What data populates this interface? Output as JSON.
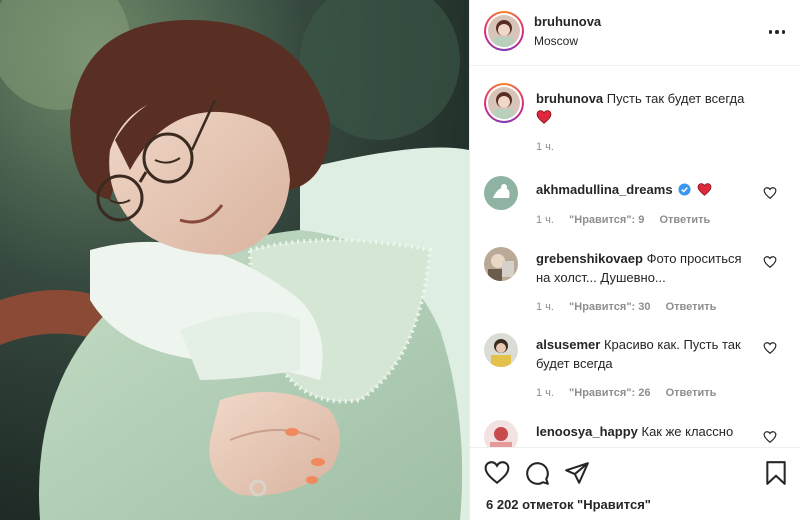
{
  "header": {
    "username": "bruhunova",
    "location": "Moscow"
  },
  "caption": {
    "username": "bruhunova",
    "text": "Пусть так будет всегда",
    "time": "1 ч."
  },
  "comments": [
    {
      "username": "akhmadullina_dreams",
      "text": "",
      "time": "1 ч.",
      "likes": "\"Нравится\": 9",
      "reply": "Ответить",
      "verified": true
    },
    {
      "username": "grebenshikovaep",
      "text": "Фото проситься на холст... Душевно...",
      "time": "1 ч.",
      "likes": "\"Нравится\": 30",
      "reply": "Ответить"
    },
    {
      "username": "alsusemer",
      "text": "Красиво как. Пусть так будет всегда",
      "time": "1 ч.",
      "likes": "\"Нравится\": 26",
      "reply": "Ответить"
    },
    {
      "username": "lenoosya_happy",
      "text": "Как же классно",
      "time": "",
      "likes": "",
      "reply": ""
    }
  ],
  "footer": {
    "likes": "6 202 отметок \"Нравится\""
  },
  "icons": {
    "heart": "heart-outline-icon",
    "comment": "comment-bubble-icon",
    "share": "paper-plane-icon",
    "save": "bookmark-icon",
    "more": "three-dots-icon"
  },
  "colors": {
    "text": "#262626",
    "muted": "#8e8e8e",
    "heart_red": "#ed4956",
    "verified": "#3897f0",
    "divider": "#efefef"
  }
}
